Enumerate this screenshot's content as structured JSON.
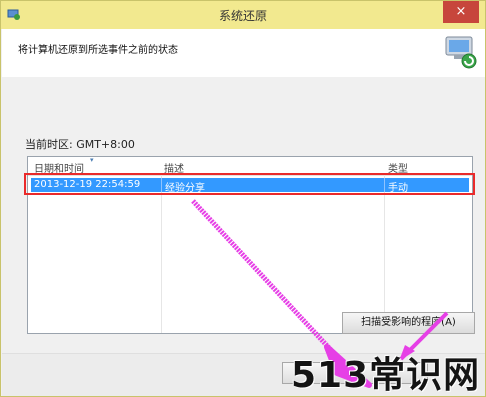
{
  "window": {
    "title": "系统还原",
    "close_label": "×"
  },
  "header": {
    "heading": "将计算机还原到所选事件之前的状态"
  },
  "timezone": "当前时区: GMT+8:00",
  "table": {
    "columns": [
      "日期和时间",
      "描述",
      "类型"
    ],
    "rows": [
      {
        "date": "2013-12-19 22:54:59",
        "description": "经验分享",
        "type": "手动"
      }
    ]
  },
  "scan_button_label": "扫描受影响的程序(A)",
  "watermark": {
    "text": "513常识网"
  },
  "colors": {
    "titlebar": "#f2e98f",
    "selection": "#3399ff",
    "highlight_box": "#ea2a2a",
    "arrow": "#e63fe6"
  }
}
